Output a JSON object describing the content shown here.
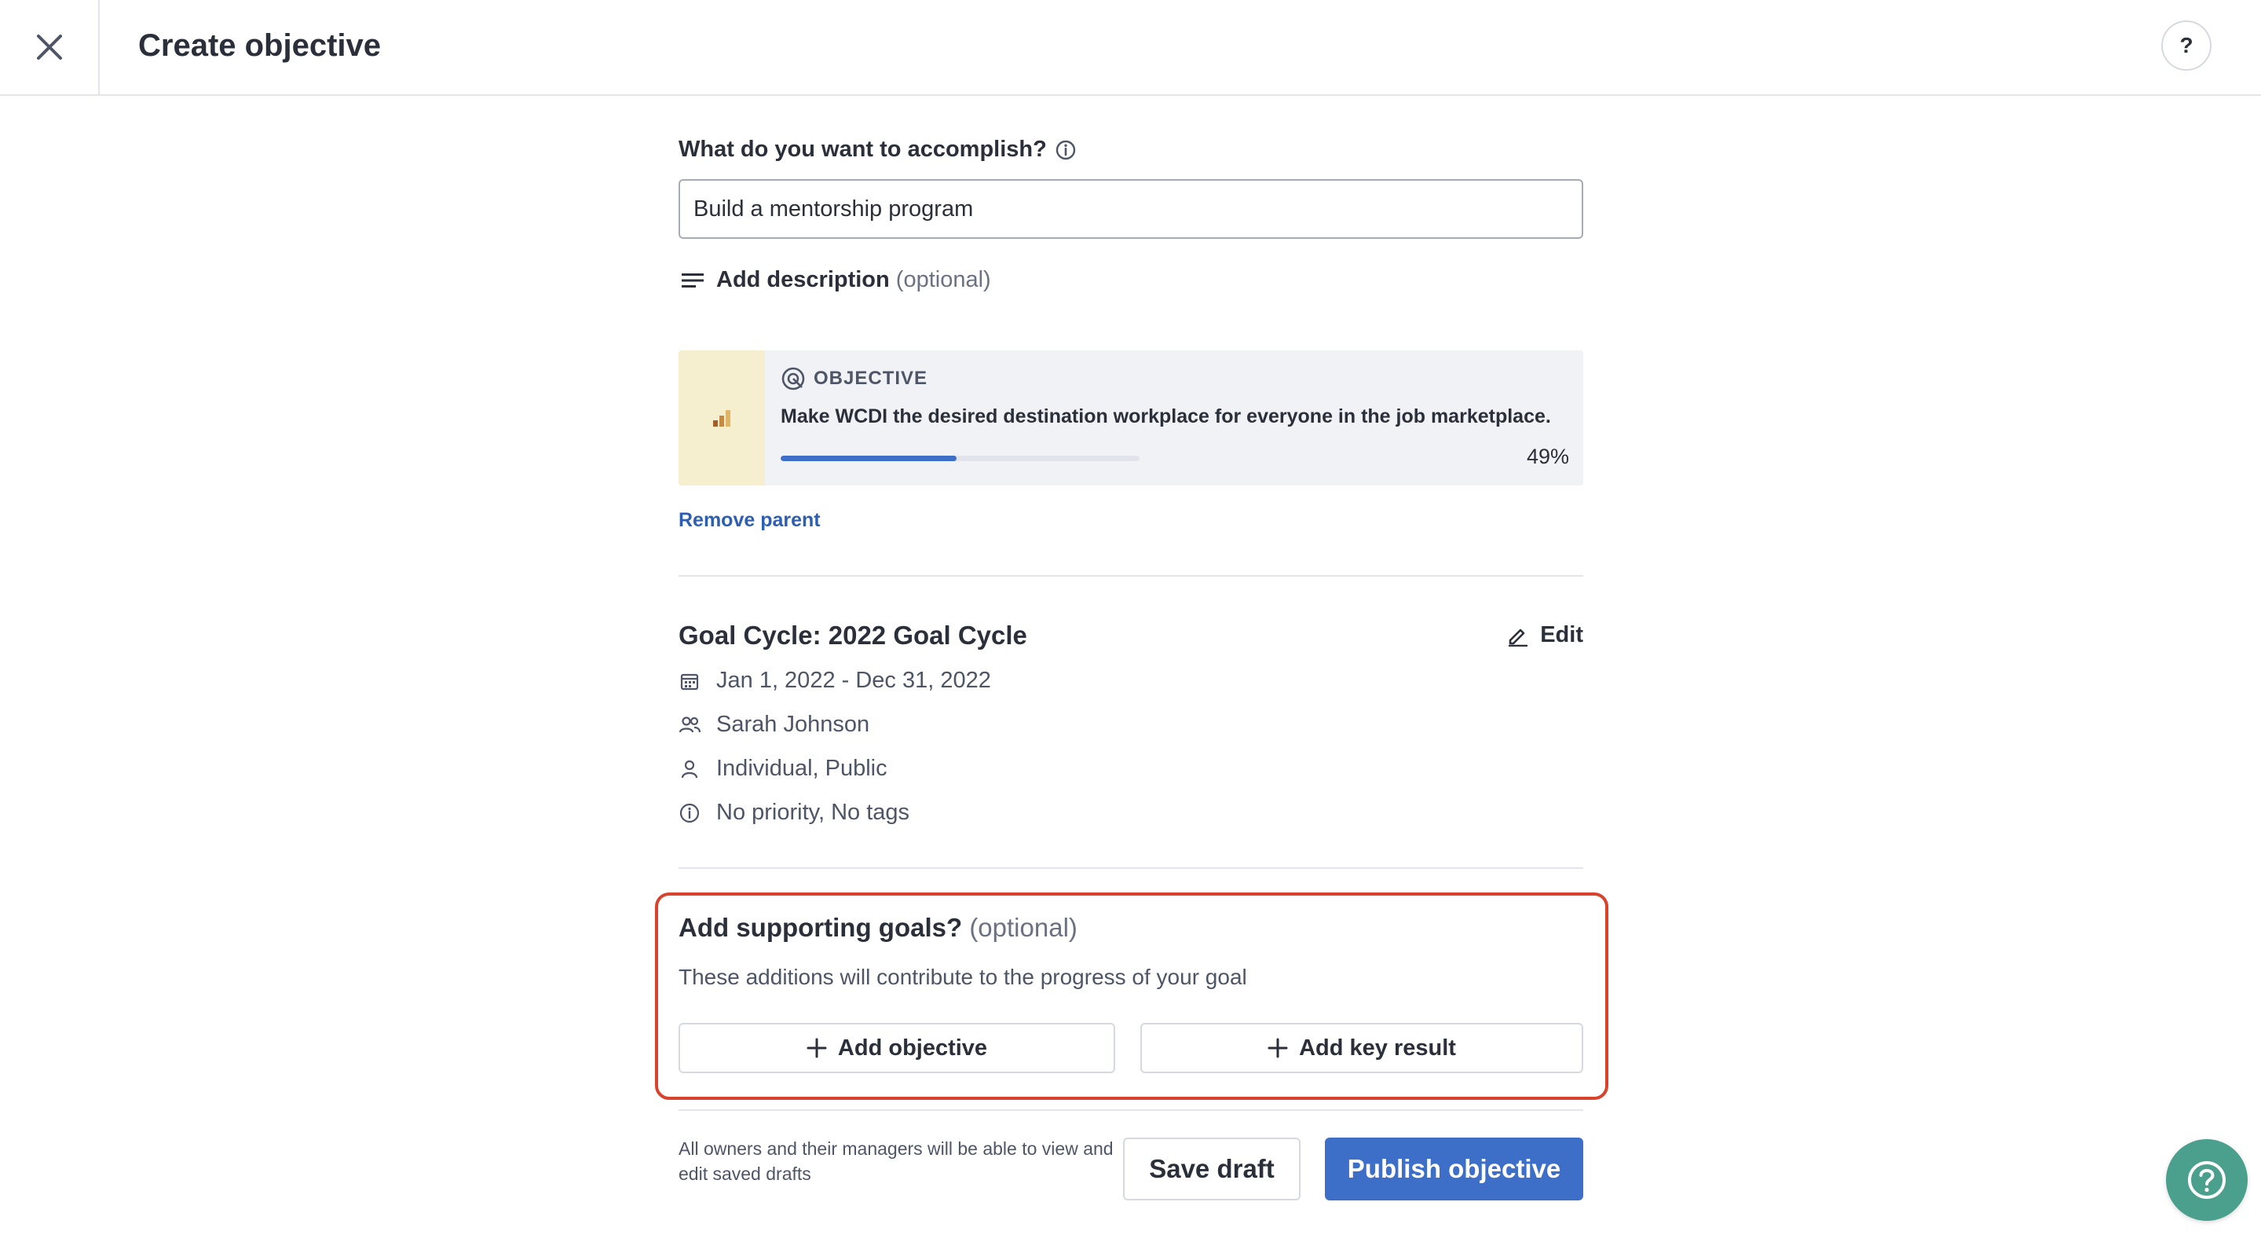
{
  "header": {
    "title": "Create objective",
    "help_label": "?"
  },
  "form": {
    "question_label": "What do you want to accomplish?",
    "title_value": "Build a mentorship program",
    "add_description_label": "Add description",
    "add_description_optional": "(optional)"
  },
  "parent": {
    "type_label": "OBJECTIVE",
    "name": "Make WCDI the desired destination workplace for everyone in the job marketplace.",
    "progress_percent": 49,
    "progress_text": "49%",
    "remove_label": "Remove parent"
  },
  "goal_cycle": {
    "title": "Goal Cycle: 2022 Goal Cycle",
    "edit_label": "Edit",
    "date_range": "Jan 1, 2022 - Dec 31, 2022",
    "owner": "Sarah Johnson",
    "visibility": "Individual, Public",
    "priority_tags": "No priority, No tags"
  },
  "supporting": {
    "title": "Add supporting goals?",
    "optional": "(optional)",
    "subtitle": "These additions will contribute to the progress of your goal",
    "add_objective_label": "Add objective",
    "add_key_result_label": "Add key result"
  },
  "footer": {
    "note": "All owners and their managers will be able to view and edit saved drafts",
    "save_draft_label": "Save draft",
    "publish_label": "Publish objective"
  },
  "colors": {
    "accent": "#3d6fc9",
    "link": "#2c5fb3",
    "highlight_border": "#d9432e",
    "help_fab": "#4a9f8d",
    "parent_icon_bg": "#f6efcf"
  },
  "icons": {
    "close": "close-icon",
    "help": "question-icon",
    "info": "info-icon",
    "description": "lines-icon",
    "objective": "target-icon",
    "chart": "bar-chart-icon",
    "edit": "pencil-icon",
    "calendar": "calendar-icon",
    "owners": "people-icon",
    "visibility": "person-icon",
    "priority": "info-icon",
    "plus": "plus-icon"
  }
}
